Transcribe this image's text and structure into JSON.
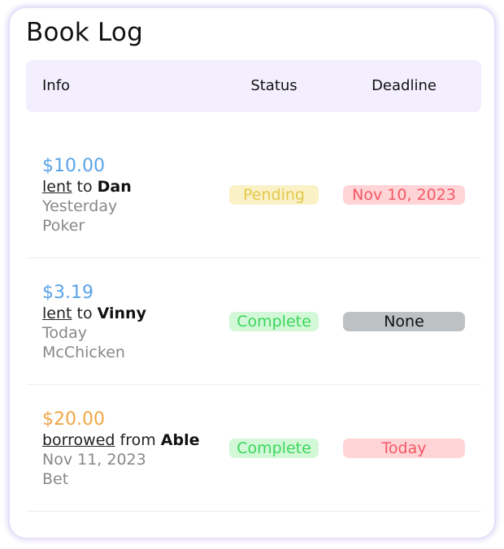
{
  "title": "Book Log",
  "table": {
    "headers": {
      "info": "Info",
      "status": "Status",
      "deadline": "Deadline"
    }
  },
  "colors": {
    "lent_amount": "#5ba3e6",
    "borrowed_amount": "#f0a646",
    "pending_bg": "#fbf1c7",
    "pending_text": "#e3c84a",
    "complete_bg": "#d2f8d8",
    "complete_text": "#3cd65a",
    "overdue_bg": "#ffd4d6",
    "overdue_text": "#f25865",
    "none_bg": "#bec1c3",
    "none_text": "#111111"
  },
  "rows": [
    {
      "amount": "$10.00",
      "verb": "lent",
      "prep": "to",
      "party": "Dan",
      "when": "Yesterday",
      "note": "Poker",
      "status": "Pending",
      "deadline": "Nov 10, 2023"
    },
    {
      "amount": "$3.19",
      "verb": "lent",
      "prep": "to",
      "party": "Vinny",
      "when": "Today",
      "note": "McChicken",
      "status": "Complete",
      "deadline": "None"
    },
    {
      "amount": "$20.00",
      "verb": "borrowed",
      "prep": "from",
      "party": "Able",
      "when": "Nov 11, 2023",
      "note": "Bet",
      "status": "Complete",
      "deadline": "Today"
    }
  ]
}
